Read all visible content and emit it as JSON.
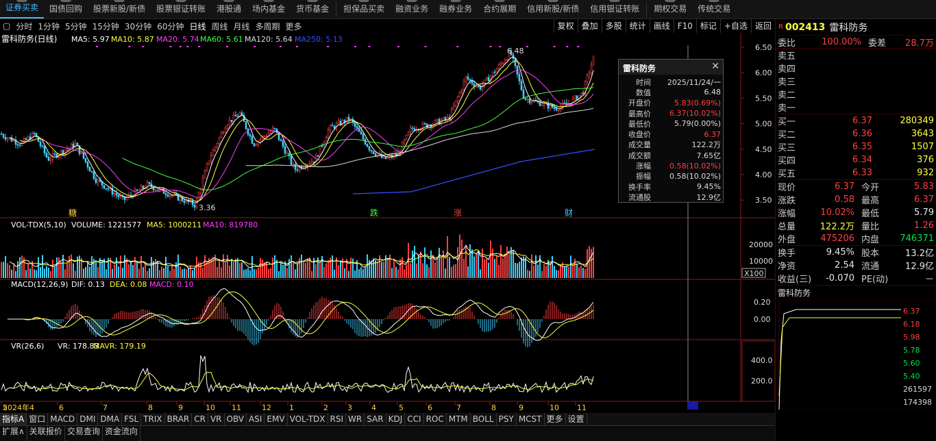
{
  "top_nav": [
    "证券买卖",
    "国债回购",
    "股票新股/新债",
    "股票银证转账",
    "港股通",
    "场内基金",
    "货币基金",
    "担保品买卖",
    "融资业务",
    "融券业务",
    "合约展期",
    "信用新股/新债",
    "信用银证转账",
    "期权交易",
    "传统交易"
  ],
  "period_bar": {
    "tabs": [
      "分时",
      "1分钟",
      "5分钟",
      "15分钟",
      "30分钟",
      "60分钟",
      "日线",
      "周线",
      "月线",
      "多周期",
      "更多"
    ],
    "active": "日线",
    "right_buttons": [
      "复权",
      "叠加",
      "多股",
      "统计",
      "画线",
      "F10",
      "标记",
      "+自选",
      "返回"
    ]
  },
  "kline_header": {
    "name": "雷科防务(日线)",
    "ma5": "MA5: 5.97",
    "ma10": "MA10: 5.87",
    "ma20": "MA20: 5.74",
    "ma60": "MA60: 5.61",
    "ma120": "MA120: 5.64",
    "ma250": "MA250: 5.13"
  },
  "price_axis": [
    "6.50",
    "6.00",
    "5.50",
    "5.00",
    "4.50",
    "4.00",
    "3.50"
  ],
  "annotations": {
    "high": "6.48",
    "low": "3.36",
    "marks": [
      "糖",
      "跌",
      "涨",
      "财"
    ]
  },
  "vol_header": {
    "name": "VOL-TDX(5,10)",
    "volume": "VOLUME: 1221577",
    "ma5": "MA5: 1000211",
    "ma10": "MA10: 819780",
    "axis": [
      "20000",
      "10000"
    ],
    "unit": "X100"
  },
  "macd_header": {
    "name": "MACD(12,26,9)",
    "dif": "DIF: 0.13",
    "dea": "DEA: 0.08",
    "macd": "MACD: 0.10",
    "axis": [
      "0.20",
      "0.00"
    ]
  },
  "vr_header": {
    "name": "VR(26,6)",
    "vr": "VR: 178.83",
    "mavr": "MAVR: 179.19",
    "axis": [
      "400.0",
      "200.0"
    ]
  },
  "time_axis": [
    "2024年4",
    "5",
    "6",
    "7",
    "8",
    "9",
    "10",
    "11",
    "12",
    "1",
    "2",
    "3",
    "4",
    "5",
    "6",
    "7",
    "8",
    "9",
    "10",
    "11"
  ],
  "popup": {
    "title": "雷科防务",
    "rows": [
      [
        "时间",
        "2025/11/24/一"
      ],
      [
        "数值",
        "6.48"
      ],
      [
        "开盘价",
        "5.83(0.69%)"
      ],
      [
        "最高价",
        "6.37(10.02%)"
      ],
      [
        "最低价",
        "5.79(0.00%)"
      ],
      [
        "收盘价",
        "6.37"
      ],
      [
        "成交量",
        "122.2万"
      ],
      [
        "成交额",
        "7.65亿"
      ],
      [
        "涨幅",
        "0.58(10.02%)"
      ],
      [
        "振幅",
        "0.58(10.02%)"
      ],
      [
        "换手率",
        "9.45%"
      ],
      [
        "流通股",
        "12.9亿"
      ]
    ]
  },
  "quote": {
    "code": "002413",
    "name": "雷科防务",
    "weibi_label": "委比",
    "weibi": "100.00%",
    "weicha_label": "委差",
    "weicha": "28.7万",
    "sell": [
      "卖五",
      "卖四",
      "卖三",
      "卖二",
      "卖一"
    ],
    "buy": [
      [
        "买一",
        "6.37",
        "280349"
      ],
      [
        "买二",
        "6.36",
        "3643"
      ],
      [
        "买三",
        "6.35",
        "1507"
      ],
      [
        "买四",
        "6.34",
        "376"
      ],
      [
        "买五",
        "6.33",
        "932"
      ]
    ],
    "stats": [
      [
        "现价",
        "6.37",
        "今开",
        "5.83"
      ],
      [
        "涨跌",
        "0.58",
        "最高",
        "6.37"
      ],
      [
        "涨幅",
        "10.02%",
        "最低",
        "5.79"
      ],
      [
        "总量",
        "122.2万",
        "量比",
        "1.26"
      ],
      [
        "外盘",
        "475206",
        "内盘",
        "746371"
      ]
    ],
    "stats2": [
      [
        "换手",
        "9.45%",
        "股本",
        "13.2亿"
      ],
      [
        "净资",
        "2.54",
        "流通",
        "12.9亿"
      ],
      [
        "收益(三)",
        "-0.070",
        "PE(动)",
        "－"
      ]
    ]
  },
  "mini_chart": {
    "title": "雷科防务",
    "axis": [
      "6.37",
      "6.18",
      "5.98",
      "5.78",
      "5.60",
      "5.40",
      "261597",
      "174398"
    ]
  },
  "bottom_tabs": [
    "指标A",
    "窗口",
    "MACD",
    "DMI",
    "DMA",
    "FSL",
    "TRIX",
    "BRAR",
    "CR",
    "VR",
    "OBV",
    "ASI",
    "EMV",
    "VOL-TDX",
    "RSI",
    "WR",
    "SAR",
    "KDJ",
    "CCI",
    "ROC",
    "MTM",
    "BOLL",
    "PSY",
    "MCST",
    "更多",
    "设置"
  ],
  "status_tabs": [
    "扩展∧",
    "关联报价",
    "交易查询",
    "资金流向"
  ],
  "colors": {
    "up": "#ff4040",
    "down": "#3fd0ff",
    "ma5": "#ffffff",
    "ma10": "#ffff40",
    "ma20": "#ff40ff",
    "ma60": "#40ff40",
    "ma250": "#3050ff"
  }
}
